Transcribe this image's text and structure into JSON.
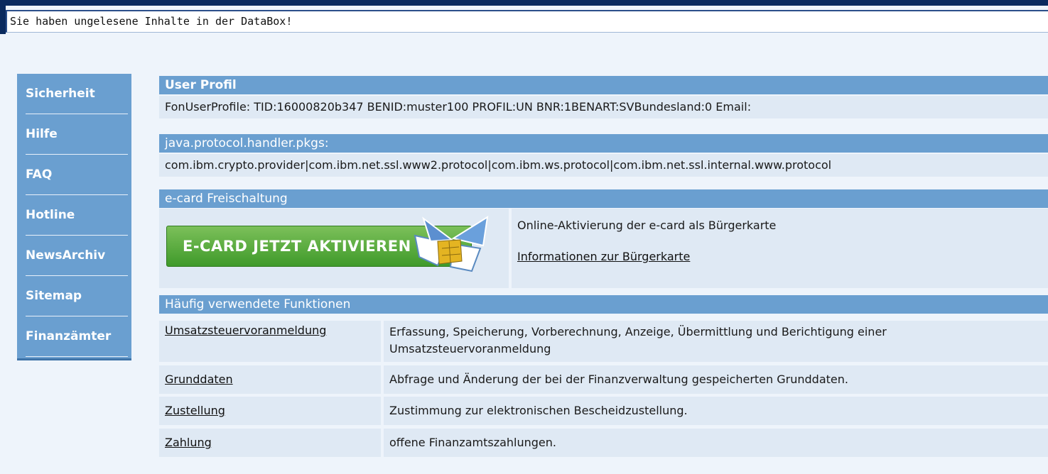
{
  "notice": {
    "text": "Sie haben ungelesene Inhalte in der DataBox!"
  },
  "sidebar": {
    "items": [
      {
        "label": "Sicherheit"
      },
      {
        "label": "Hilfe"
      },
      {
        "label": "FAQ"
      },
      {
        "label": "Hotline"
      },
      {
        "label": "NewsArchiv"
      },
      {
        "label": "Sitemap"
      },
      {
        "label": "Finanzämter"
      }
    ]
  },
  "user_profile": {
    "header": "User Profil",
    "text": "FonUserProfile: TID:16000820b347 BENID:muster100 PROFIL:UN BNR:1BENART:SVBundesland:0 Email:"
  },
  "protocol": {
    "header": "java.protocol.handler.pkgs:",
    "text": "com.ibm.crypto.provider|com.ibm.net.ssl.www2.protocol|com.ibm.ws.protocol|com.ibm.net.ssl.internal.www.protocol"
  },
  "ecard": {
    "header": "e-card Freischaltung",
    "button_label": "E-CARD JETZT AKTIVIEREN",
    "description": "Online-Aktivierung der e-card als Bürgerkarte",
    "info_link": "Informationen zur Bürgerkarte"
  },
  "functions": {
    "header": "Häufig verwendete Funktionen",
    "rows": [
      {
        "link": "Umsatzsteuervoranmeldung",
        "description": "Erfassung, Speicherung, Vorberechnung, Anzeige, Übermittlung und Berichtigung einer Umsatzsteuervoranmeldung"
      },
      {
        "link": "Grunddaten",
        "description": "Abfrage und Änderung der bei der Finanzverwaltung gespeicherten Grunddaten."
      },
      {
        "link": "Zustellung",
        "description": "Zustimmung zur elektronischen Bescheidzustellung."
      },
      {
        "link": "Zahlung",
        "description": "offene Finanzamtszahlungen."
      }
    ]
  },
  "colors": {
    "header_blue": "#6a9fd0",
    "row_bg": "#dfe9f4",
    "button_green": "#4aa535"
  }
}
